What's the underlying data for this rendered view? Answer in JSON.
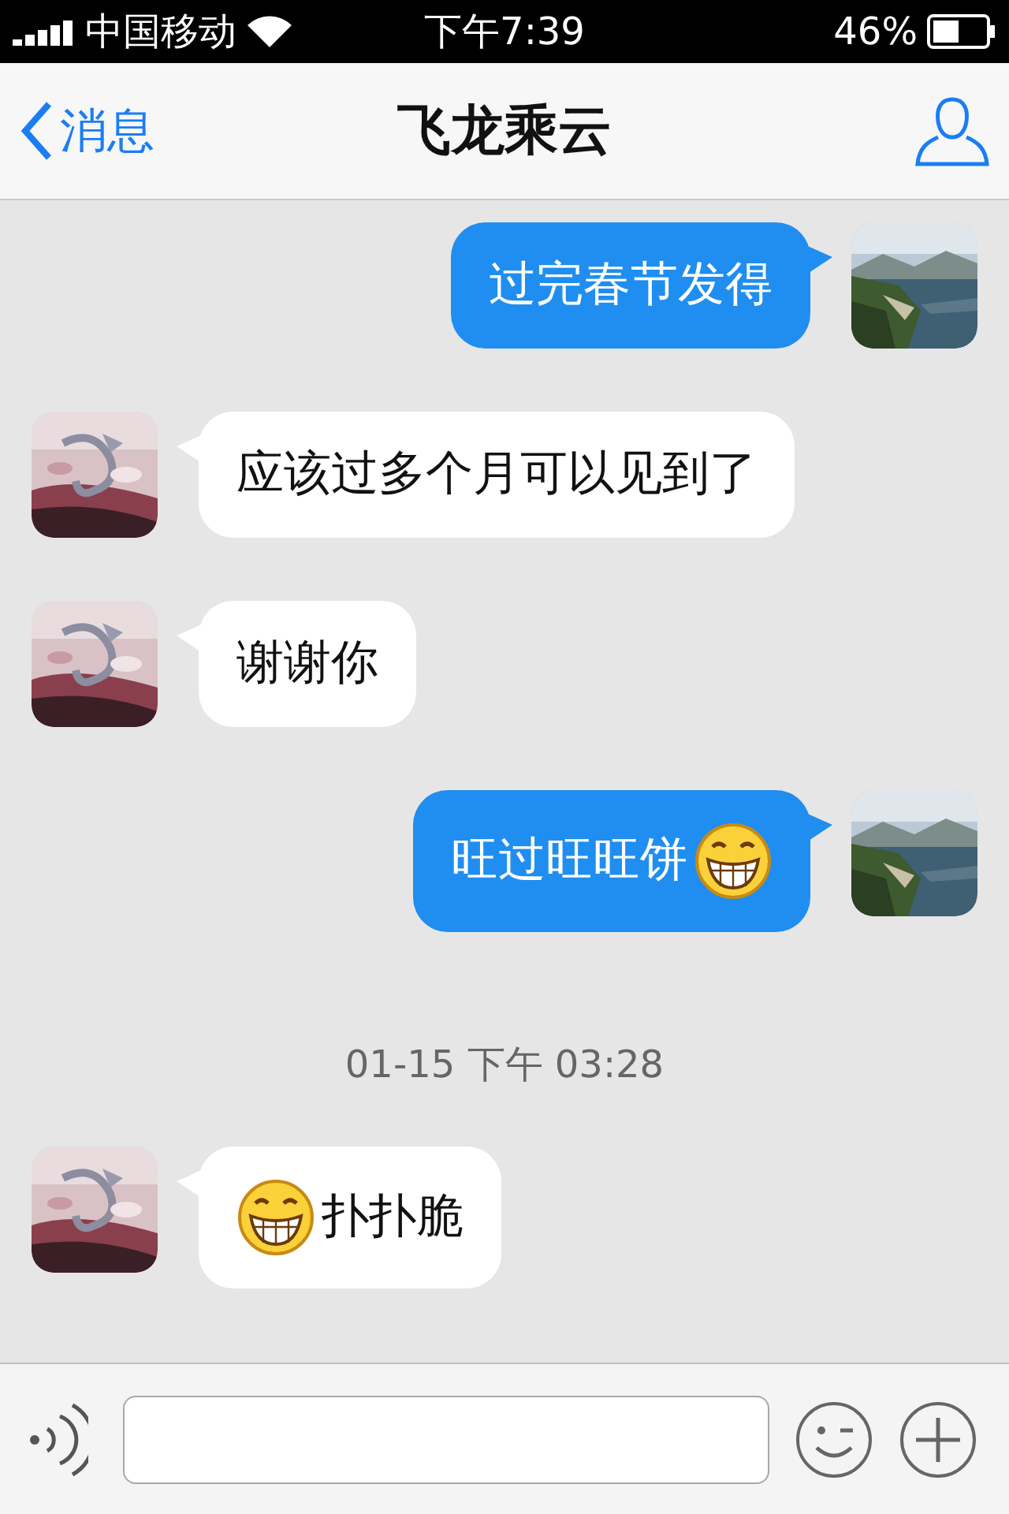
{
  "status_bar": {
    "carrier": "中国移动",
    "time": "下午7:39",
    "battery": "46%"
  },
  "nav_bar": {
    "back_label": "消息",
    "title": "飞龙乘云"
  },
  "messages": [
    {
      "kind": "outgoing",
      "parts": [
        {
          "kind": "text",
          "text": "过完春节发得"
        }
      ]
    },
    {
      "kind": "incoming",
      "parts": [
        {
          "kind": "text",
          "text": "应该过多个月可以见到了"
        }
      ]
    },
    {
      "kind": "incoming",
      "parts": [
        {
          "kind": "text",
          "text": "谢谢你"
        }
      ]
    },
    {
      "kind": "outgoing",
      "parts": [
        {
          "kind": "text",
          "text": "旺过旺旺饼"
        },
        {
          "kind": "emoji"
        }
      ]
    },
    {
      "kind": "timestamp",
      "text": "01-15 下午 03:28"
    },
    {
      "kind": "incoming",
      "parts": [
        {
          "kind": "emoji"
        },
        {
          "kind": "text",
          "text": "扑扑脆"
        }
      ]
    }
  ]
}
